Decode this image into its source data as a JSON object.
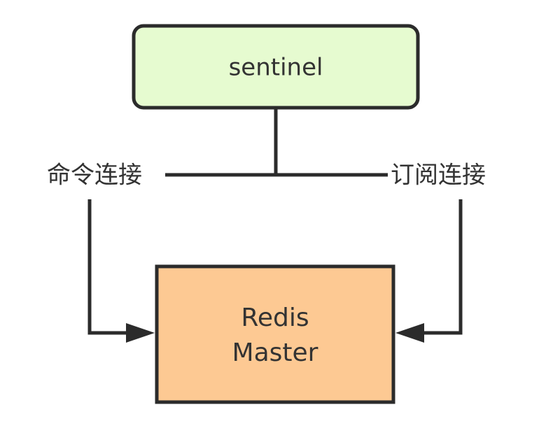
{
  "nodes": {
    "sentinel": {
      "label": "sentinel",
      "fill": "#e6fbd0"
    },
    "master": {
      "line1": "Redis",
      "line2": "Master",
      "fill": "#fdc993"
    }
  },
  "edges": {
    "command": {
      "label": "命令连接"
    },
    "subscribe": {
      "label": "订阅连接"
    }
  },
  "colors": {
    "stroke": "#2b2b2b",
    "text": "#333333"
  }
}
